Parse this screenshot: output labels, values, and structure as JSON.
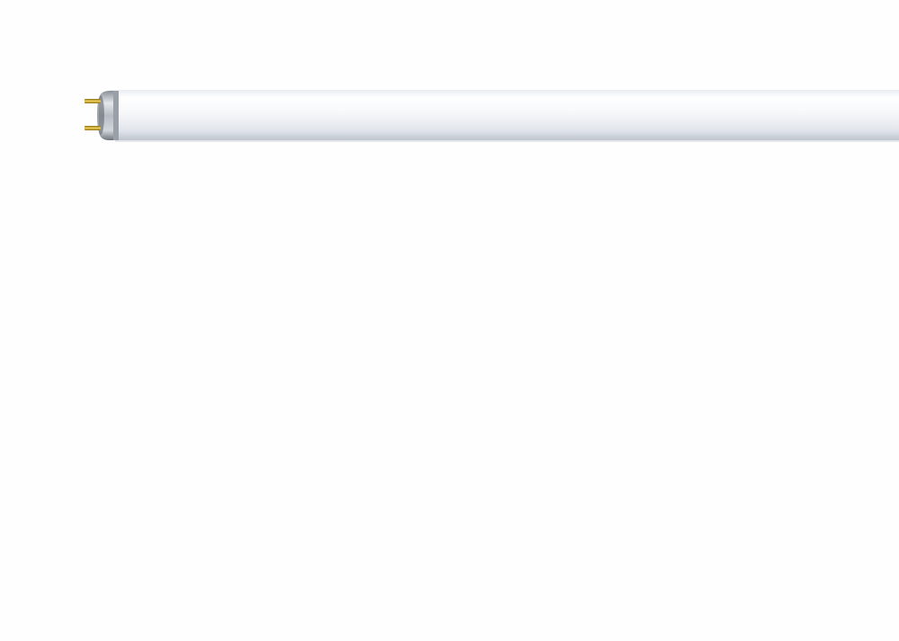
{
  "scene": {
    "subject": "fluorescent-tube-lamp",
    "colors": {
      "background": "#fefefe",
      "glass": "#f2f4f7",
      "glass_shadow": "#c9ced6",
      "end_cap": "#b9bec5",
      "end_cap_dark": "#7e848c",
      "pins": "#c9a227"
    }
  }
}
